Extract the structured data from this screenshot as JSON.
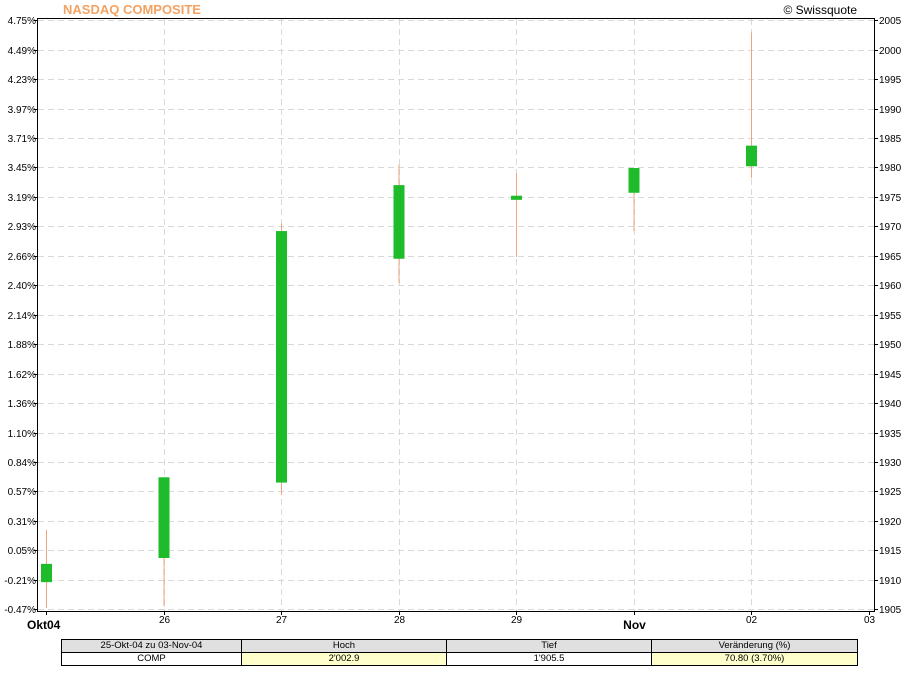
{
  "header": {
    "title": "NASDAQ COMPOSITE",
    "copyright": "© Swissquote"
  },
  "chart_data": {
    "type": "candlestick",
    "title": "NASDAQ COMPOSITE",
    "x_tick_labels": [
      "Okt04",
      "26",
      "27",
      "28",
      "29",
      "Nov",
      "02",
      "03"
    ],
    "x_tick_bold": [
      true,
      false,
      false,
      false,
      false,
      true,
      false,
      false
    ],
    "y_left_ticks": [
      "4.75%",
      "4.49%",
      "4.23%",
      "3.97%",
      "3.71%",
      "3.45%",
      "3.19%",
      "2.93%",
      "2.66%",
      "2.40%",
      "2.14%",
      "1.88%",
      "1.62%",
      "1.36%",
      "1.10%",
      "0.84%",
      "0.57%",
      "0.31%",
      "0.05%",
      "-0.21%",
      "-0.47%"
    ],
    "y_right_ticks": [
      2005,
      2000,
      1995,
      1990,
      1985,
      1980,
      1975,
      1970,
      1965,
      1960,
      1955,
      1950,
      1945,
      1940,
      1935,
      1930,
      1925,
      1920,
      1915,
      1910,
      1905
    ],
    "ylim": [
      1904.7,
      2005.2
    ],
    "grid": true,
    "candles": [
      {
        "x": "25",
        "open": 1909.6,
        "high": 1918.5,
        "low": 1905.2,
        "close": 1912.7
      },
      {
        "x": "26",
        "open": 1913.7,
        "high": 1927.4,
        "low": 1905.5,
        "close": 1927.4
      },
      {
        "x": "27",
        "open": 1926.5,
        "high": 1970.5,
        "low": 1924.4,
        "close": 1969.2
      },
      {
        "x": "28",
        "open": 1964.5,
        "high": 1980.5,
        "low": 1960.4,
        "close": 1977.0
      },
      {
        "x": "29",
        "open": 1974.5,
        "high": 1979.0,
        "low": 1964.8,
        "close": 1975.2
      },
      {
        "x": "01",
        "open": 1975.7,
        "high": 1978.8,
        "low": 1969.2,
        "close": 1979.9
      },
      {
        "x": "02",
        "open": 1980.2,
        "high": 2002.9,
        "low": 1978.2,
        "close": 1983.7
      }
    ],
    "colors": {
      "candle_up": "#1ebb2a",
      "wick": "#f0a57e",
      "grid": "#d9d9d9",
      "title": "#f4a262"
    }
  },
  "stats_table": {
    "headers": [
      "25-Okt-04 zu 03-Nov-04",
      "Hoch",
      "Tief",
      "Veränderung (%)"
    ],
    "row": [
      "COMP",
      "2'002.9",
      "1'905.5",
      "70.80 (3.70%)"
    ]
  }
}
